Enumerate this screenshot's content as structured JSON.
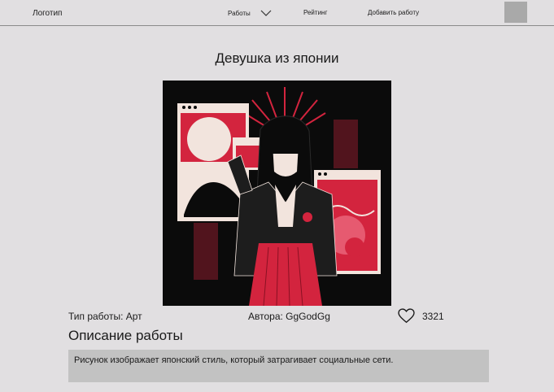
{
  "header": {
    "logo": "Логотип",
    "nav": {
      "works": "Работы",
      "rating": "Рейтинг",
      "add_work": "Добавить работу"
    }
  },
  "artwork": {
    "title": "Девушка из японии",
    "type_label": "Тип работы: Арт",
    "author_label": "Автора: GgGodGg",
    "likes": "3321"
  },
  "description": {
    "heading": "Описание работы",
    "text": "Рисунок изображает японский стиль, который затрагивает социальные сети."
  },
  "colors": {
    "background": "#e1dfe1",
    "accent_red": "#d3243e",
    "art_black": "#0b0b0b",
    "description_box": "#c2c2c2",
    "avatar": "#a9a9a9"
  }
}
